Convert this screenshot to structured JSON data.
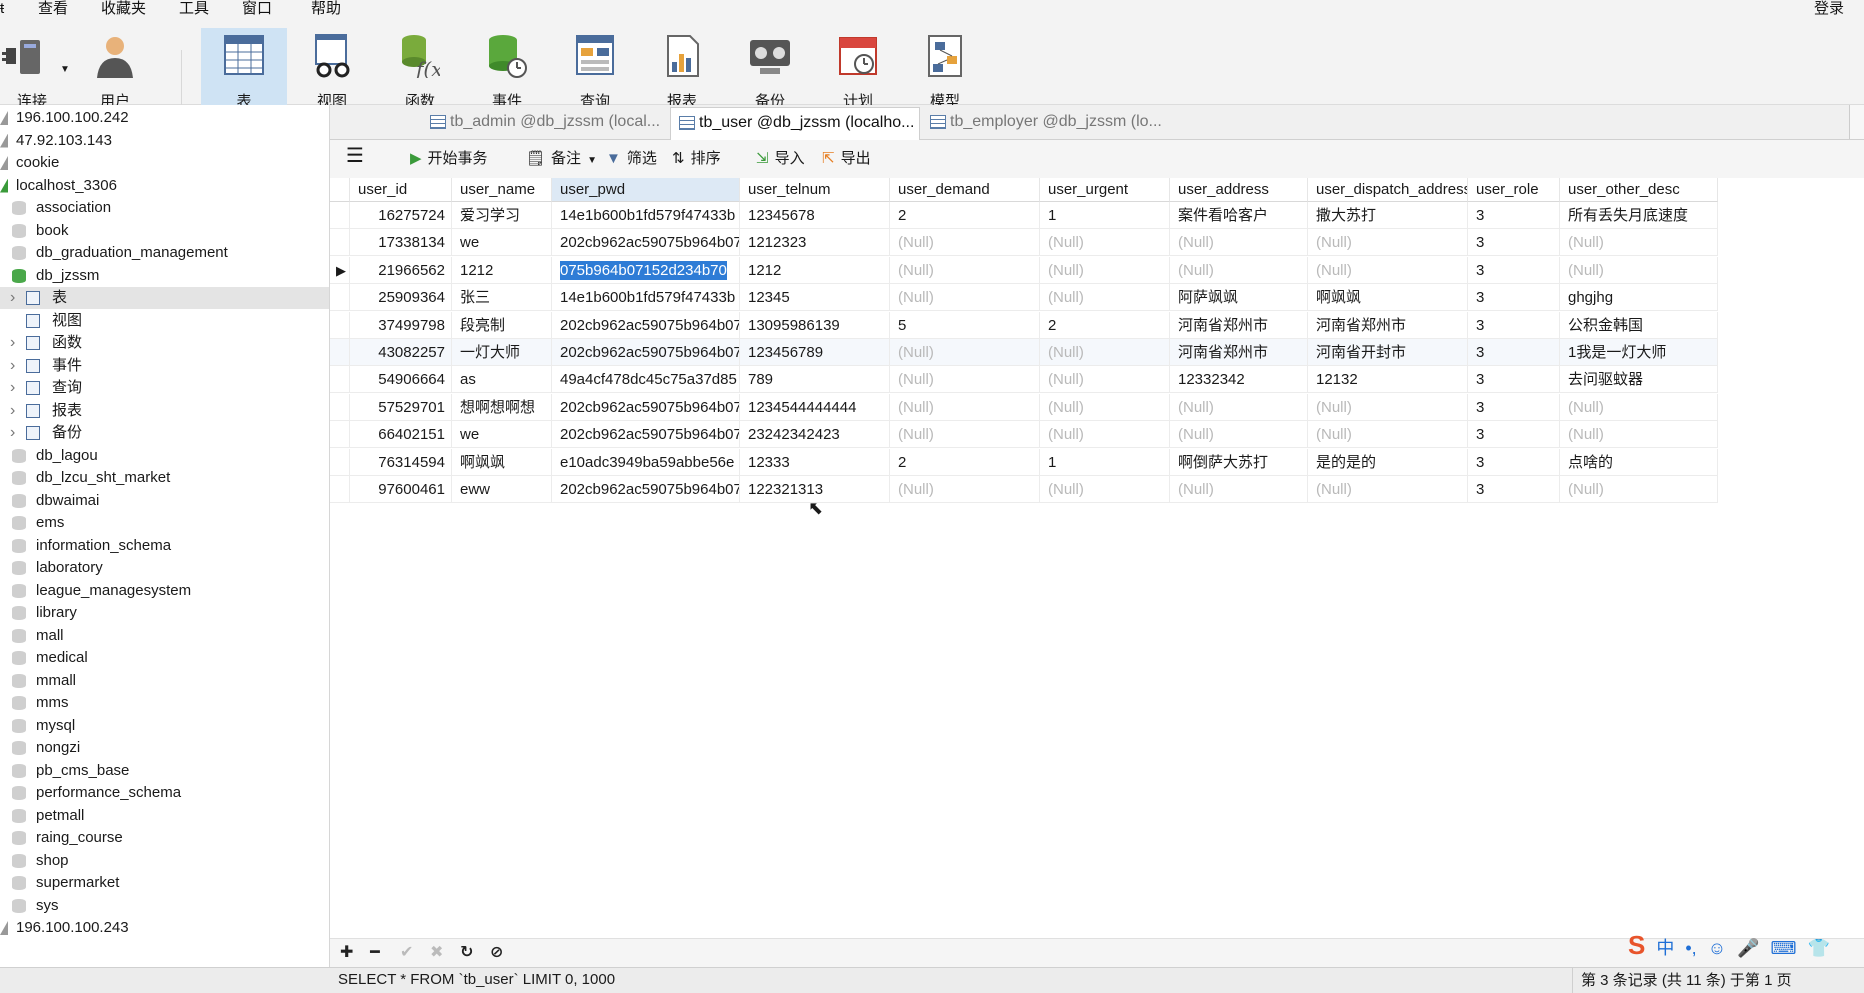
{
  "menu": [
    "查看",
    "收藏夹",
    "工具",
    "窗口",
    "帮助"
  ],
  "login_label": "登录",
  "toolbar": [
    {
      "label": "连接",
      "icon": "plug-icon"
    },
    {
      "label": "用户",
      "icon": "user-icon"
    },
    {
      "label": "表",
      "icon": "table-icon"
    },
    {
      "label": "视图",
      "icon": "view-glasses-icon"
    },
    {
      "label": "函数",
      "icon": "function-icon"
    },
    {
      "label": "事件",
      "icon": "event-clock-icon"
    },
    {
      "label": "查询",
      "icon": "query-icon"
    },
    {
      "label": "报表",
      "icon": "report-icon"
    },
    {
      "label": "备份",
      "icon": "backup-icon"
    },
    {
      "label": "计划",
      "icon": "schedule-icon"
    },
    {
      "label": "模型",
      "icon": "model-icon"
    }
  ],
  "sidebar": {
    "items": [
      {
        "label": "196.100.100.242",
        "kind": "conn"
      },
      {
        "label": "47.92.103.143",
        "kind": "conn"
      },
      {
        "label": "cookie",
        "kind": "conn"
      },
      {
        "label": "localhost_3306",
        "kind": "conn-open"
      },
      {
        "label": "association",
        "kind": "db"
      },
      {
        "label": "book",
        "kind": "db"
      },
      {
        "label": "db_graduation_management",
        "kind": "db"
      },
      {
        "label": "db_jzssm",
        "kind": "db-open"
      },
      {
        "label": "表",
        "kind": "node-table"
      },
      {
        "label": "视图",
        "kind": "node-view"
      },
      {
        "label": "函数",
        "kind": "node-func"
      },
      {
        "label": "事件",
        "kind": "node-event"
      },
      {
        "label": "查询",
        "kind": "node-query"
      },
      {
        "label": "报表",
        "kind": "node-report"
      },
      {
        "label": "备份",
        "kind": "node-backup"
      },
      {
        "label": "db_lagou",
        "kind": "db"
      },
      {
        "label": "db_lzcu_sht_market",
        "kind": "db"
      },
      {
        "label": "dbwaimai",
        "kind": "db"
      },
      {
        "label": "ems",
        "kind": "db"
      },
      {
        "label": "information_schema",
        "kind": "db"
      },
      {
        "label": "laboratory",
        "kind": "db"
      },
      {
        "label": "league_managesystem",
        "kind": "db"
      },
      {
        "label": "library",
        "kind": "db"
      },
      {
        "label": "mall",
        "kind": "db"
      },
      {
        "label": "medical",
        "kind": "db"
      },
      {
        "label": "mmall",
        "kind": "db"
      },
      {
        "label": "mms",
        "kind": "db"
      },
      {
        "label": "mysql",
        "kind": "db"
      },
      {
        "label": "nongzi",
        "kind": "db"
      },
      {
        "label": "pb_cms_base",
        "kind": "db"
      },
      {
        "label": "performance_schema",
        "kind": "db"
      },
      {
        "label": "petmall",
        "kind": "db"
      },
      {
        "label": "raing_course",
        "kind": "db"
      },
      {
        "label": "shop",
        "kind": "db"
      },
      {
        "label": "supermarket",
        "kind": "db"
      },
      {
        "label": "sys",
        "kind": "db"
      },
      {
        "label": "196.100.100.243",
        "kind": "conn"
      }
    ]
  },
  "tabs": [
    {
      "label": "tb_admin @db_jzssm (local...",
      "active": false
    },
    {
      "label": "tb_user @db_jzssm (localho...",
      "active": true
    },
    {
      "label": "tb_employer @db_jzssm (lo...",
      "active": false
    }
  ],
  "subtoolbar": [
    {
      "label": "开始事务",
      "icon": "transaction-icon"
    },
    {
      "label": "备注",
      "icon": "memo-icon"
    },
    {
      "label": "筛选",
      "icon": "filter-icon"
    },
    {
      "label": "排序",
      "icon": "sort-icon"
    },
    {
      "label": "导入",
      "icon": "import-icon"
    },
    {
      "label": "导出",
      "icon": "export-icon"
    }
  ],
  "grid": {
    "columns": [
      "user_id",
      "user_name",
      "user_pwd",
      "user_telnum",
      "user_demand",
      "user_urgent",
      "user_address",
      "user_dispatch_address",
      "user_role",
      "user_other_desc"
    ],
    "rows": [
      [
        "16275724",
        "爱习学习",
        "14e1b600b1fd579f47433b",
        "12345678",
        "2",
        "1",
        "案件看哈客户",
        "撒大苏打",
        "3",
        "所有丢失月底速度"
      ],
      [
        "17338134",
        "we",
        "202cb962ac59075b964b07",
        "1212323",
        "(Null)",
        "(Null)",
        "(Null)",
        "(Null)",
        "3",
        "(Null)"
      ],
      [
        "21966562",
        "1212",
        "075b964b07152d234b70",
        "1212",
        "(Null)",
        "(Null)",
        "(Null)",
        "(Null)",
        "3",
        "(Null)"
      ],
      [
        "25909364",
        "张三",
        "14e1b600b1fd579f47433b",
        "12345",
        "(Null)",
        "(Null)",
        "阿萨飒飒",
        "啊飒飒",
        "3",
        "ghgjhg"
      ],
      [
        "37499798",
        "段亮制",
        "202cb962ac59075b964b07",
        "13095986139",
        "5",
        "2",
        "河南省郑州市",
        "河南省郑州市",
        "3",
        "公积金韩国"
      ],
      [
        "43082257",
        "一灯大师",
        "202cb962ac59075b964b07",
        "123456789",
        "(Null)",
        "(Null)",
        "河南省郑州市",
        "河南省开封市",
        "3",
        "1我是一灯大师"
      ],
      [
        "54906664",
        "as",
        "49a4cf478dc45c75a37d85",
        "789",
        "(Null)",
        "(Null)",
        "12332342",
        "12132",
        "3",
        "去问驱蚊器"
      ],
      [
        "57529701",
        "想啊想啊想",
        "202cb962ac59075b964b07",
        "1234544444444",
        "(Null)",
        "(Null)",
        "(Null)",
        "(Null)",
        "3",
        "(Null)"
      ],
      [
        "66402151",
        "we",
        "202cb962ac59075b964b07",
        "23242342423",
        "(Null)",
        "(Null)",
        "(Null)",
        "(Null)",
        "3",
        "(Null)"
      ],
      [
        "76314594",
        "啊飒飒",
        "e10adc3949ba59abbe56e",
        "12333",
        "2",
        "1",
        "啊倒萨大苏打",
        "是的是的",
        "3",
        "点啥的"
      ],
      [
        "97600461",
        "eww",
        "202cb962ac59075b964b07",
        "122321313",
        "(Null)",
        "(Null)",
        "(Null)",
        "(Null)",
        "3",
        "(Null)"
      ]
    ],
    "selected_row": 2,
    "selected_col": 2
  },
  "status": {
    "sql": "SELECT * FROM `tb_user` LIMIT 0, 1000",
    "record_info": "第 3 条记录 (共 11 条) 于第 1 页"
  },
  "ime": [
    "中",
    "•,",
    "☺",
    "🎤",
    "⌨",
    "👕"
  ]
}
